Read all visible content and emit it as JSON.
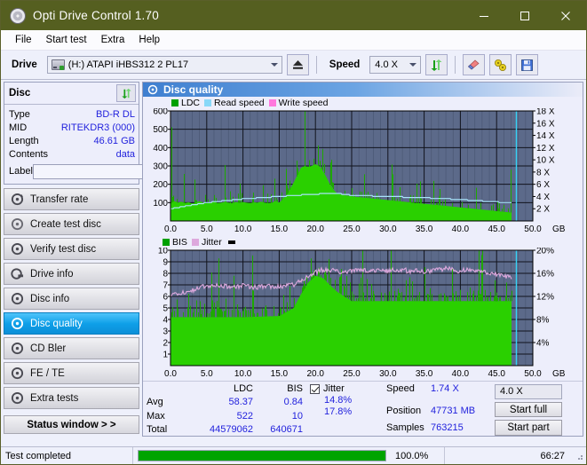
{
  "window": {
    "title": "Opti Drive Control 1.70",
    "icon": "disc-icon",
    "minimize": "minimize",
    "maximize": "maximize",
    "close": "close"
  },
  "menu": {
    "items": [
      {
        "label": "File",
        "name": "menu-file"
      },
      {
        "label": "Start test",
        "name": "menu-start-test"
      },
      {
        "label": "Extra",
        "name": "menu-extra"
      },
      {
        "label": "Help",
        "name": "menu-help"
      }
    ]
  },
  "toolbar": {
    "drive_label": "Drive",
    "drive_value": "(H:)  ATAPI iHBS312  2 PL17",
    "eject_icon": "eject-icon",
    "speed_label": "Speed",
    "speed_value": "4.0 X",
    "refresh_icon": "refresh-icon",
    "erase_icon": "eraser-icon",
    "tools_icon": "tools-icon",
    "save_icon": "save-icon"
  },
  "disc_panel": {
    "title": "Disc",
    "refresh_icon": "refresh-icon",
    "rows": [
      {
        "key": "Type",
        "value": "BD-R DL"
      },
      {
        "key": "MID",
        "value": "RITEKDR3 (000)"
      },
      {
        "key": "Length",
        "value": "46.61 GB"
      },
      {
        "key": "Contents",
        "value": "data"
      }
    ],
    "label_key": "Label",
    "label_value": "",
    "label_placeholder": "",
    "disc_button_icon": "cd-icon"
  },
  "nav": {
    "items": [
      {
        "label": "Transfer rate",
        "name": "sidebar-item-transfer-rate",
        "active": false
      },
      {
        "label": "Create test disc",
        "name": "sidebar-item-create-test-disc",
        "active": false
      },
      {
        "label": "Verify test disc",
        "name": "sidebar-item-verify-test-disc",
        "active": false
      },
      {
        "label": "Drive info",
        "name": "sidebar-item-drive-info",
        "active": false
      },
      {
        "label": "Disc info",
        "name": "sidebar-item-disc-info",
        "active": false
      },
      {
        "label": "Disc quality",
        "name": "sidebar-item-disc-quality",
        "active": true
      },
      {
        "label": "CD Bler",
        "name": "sidebar-item-cd-bler",
        "active": false
      },
      {
        "label": "FE / TE",
        "name": "sidebar-item-fe-te",
        "active": false
      },
      {
        "label": "Extra tests",
        "name": "sidebar-item-extra-tests",
        "active": false
      }
    ],
    "status_window": "Status window > >"
  },
  "panel": {
    "title": "Disc quality",
    "icon": "disc-quality-icon"
  },
  "chart_data": [
    {
      "type": "area",
      "name": "ldc-chart",
      "title": "",
      "xlabel": "GB",
      "ylabel": "",
      "xlim": [
        0,
        50
      ],
      "ylim": [
        0,
        600
      ],
      "y2lim": [
        0,
        18
      ],
      "y2label": "X",
      "grid": true,
      "legend_position": "top-left",
      "legend": [
        {
          "label": "LDC",
          "color": "#00a000"
        },
        {
          "label": "Read speed",
          "color": "#88d8f8"
        },
        {
          "label": "Write speed",
          "color": "#ff77dd"
        }
      ],
      "xticks": [
        "0.0",
        "5.0",
        "10.0",
        "15.0",
        "20.0",
        "25.0",
        "30.0",
        "35.0",
        "40.0",
        "45.0",
        "50.0"
      ],
      "yticks": [
        100,
        200,
        300,
        400,
        500,
        600
      ],
      "y2ticks": [
        "2 X",
        "4 X",
        "6 X",
        "8 X",
        "10 X",
        "12 X",
        "14 X",
        "16 X",
        "18 X"
      ],
      "data_end_gb": 47.0,
      "cursor_gb": 47.73,
      "series": [
        {
          "name": "LDC",
          "color": "#22c000",
          "x": [
            0,
            0.5,
            1,
            1.5,
            2,
            2.5,
            3,
            3.5,
            4,
            4.5,
            5,
            5.5,
            6,
            6.5,
            7,
            7.5,
            8,
            8.5,
            9,
            9.5,
            10,
            10.5,
            11,
            11.5,
            12,
            12.5,
            13,
            13.5,
            14,
            14.5,
            15,
            15.5,
            16,
            16.5,
            17,
            17.5,
            18,
            18.5,
            19,
            19.5,
            20,
            20.5,
            21,
            21.5,
            22,
            22.5,
            23,
            23.5,
            24,
            24.5,
            25,
            25.5,
            26,
            26.5,
            27,
            27.5,
            28,
            28.5,
            29,
            29.5,
            30,
            30.5,
            31,
            31.5,
            32,
            32.5,
            33,
            33.5,
            34,
            34.5,
            35,
            35.5,
            36,
            36.5,
            37,
            37.5,
            38,
            38.5,
            39,
            39.5,
            40,
            40.5,
            41,
            41.5,
            42,
            42.5,
            43,
            43.5,
            44,
            44.5,
            45,
            45.5,
            46,
            46.5,
            47
          ],
          "values": [
            95,
            110,
            100,
            105,
            98,
            102,
            95,
            100,
            108,
            100,
            96,
            100,
            105,
            98,
            100,
            104,
            100,
            98,
            104,
            100,
            103,
            100,
            98,
            102,
            100,
            105,
            100,
            98,
            100,
            110,
            100,
            120,
            140,
            175,
            210,
            250,
            290,
            300,
            295,
            300,
            310,
            300,
            275,
            240,
            200,
            170,
            150,
            145,
            140,
            138,
            135,
            132,
            130,
            128,
            126,
            124,
            122,
            120,
            118,
            116,
            114,
            112,
            110,
            108,
            106,
            104,
            102,
            100,
            98,
            96,
            94,
            92,
            90,
            88,
            86,
            84,
            82,
            80,
            78,
            76,
            74,
            72,
            70,
            68,
            66,
            64,
            62,
            60,
            58,
            56,
            54,
            52,
            50,
            48,
            46
          ]
        },
        {
          "name": "Read speed",
          "color": "#a8e4fb",
          "x": [
            0,
            5,
            10,
            15,
            20,
            23,
            25,
            30,
            35,
            40,
            45,
            47
          ],
          "values": [
            2.0,
            3.0,
            3.6,
            4.0,
            4.4,
            4.5,
            4.2,
            4.0,
            3.8,
            3.5,
            3.1,
            3.0
          ]
        }
      ],
      "spikes_max": 522
    },
    {
      "type": "area",
      "name": "bis-jitter-chart",
      "title": "",
      "xlabel": "GB",
      "ylabel": "",
      "xlim": [
        0,
        50
      ],
      "ylim": [
        0,
        10
      ],
      "y2lim": [
        0,
        20
      ],
      "y2label": "%",
      "grid": true,
      "legend_position": "top-left",
      "legend": [
        {
          "label": "BIS",
          "color": "#00a000"
        },
        {
          "label": "Jitter",
          "color": "#dda8dd"
        }
      ],
      "xticks": [
        "0.0",
        "5.0",
        "10.0",
        "15.0",
        "20.0",
        "25.0",
        "30.0",
        "35.0",
        "40.0",
        "45.0",
        "50.0"
      ],
      "yticks": [
        1,
        2,
        3,
        4,
        5,
        6,
        7,
        8,
        9,
        10
      ],
      "y2ticks": [
        "4%",
        "8%",
        "12%",
        "16%",
        "20%"
      ],
      "data_end_gb": 47.0,
      "cursor_gb": 47.73,
      "series": [
        {
          "name": "BIS",
          "color": "#22c000",
          "x": [
            0,
            5,
            10,
            15,
            17,
            18,
            19,
            20,
            21,
            22,
            23,
            25,
            30,
            35,
            40,
            45,
            47
          ],
          "values": [
            4.2,
            4.2,
            4.2,
            4.3,
            5.0,
            6.2,
            7.2,
            7.8,
            7.6,
            7.0,
            6.4,
            5.6,
            5.6,
            5.6,
            5.6,
            5.6,
            5.6
          ]
        },
        {
          "name": "Jitter",
          "color": "#dda8dd",
          "x": [
            0,
            1,
            2,
            3,
            4,
            5,
            6,
            7,
            8,
            9,
            10,
            11,
            12,
            13,
            14,
            15,
            16,
            17,
            18,
            19,
            20,
            21,
            22,
            23,
            24,
            25,
            26,
            27,
            28,
            29,
            30,
            31,
            32,
            33,
            34,
            35,
            36,
            37,
            38,
            39,
            40,
            41,
            42,
            43,
            44,
            45,
            46,
            47
          ],
          "values": [
            6.1,
            6.3,
            6.4,
            6.5,
            6.8,
            6.9,
            6.9,
            6.9,
            6.9,
            6.85,
            6.9,
            6.85,
            6.8,
            6.85,
            6.9,
            6.85,
            6.9,
            7.0,
            7.4,
            7.8,
            8.1,
            8.3,
            8.3,
            8.2,
            8.1,
            8.2,
            8.3,
            8.2,
            8.2,
            8.3,
            8.2,
            8.3,
            8.3,
            8.2,
            8.2,
            8.1,
            8.2,
            8.3,
            8.4,
            8.3,
            8.2,
            8.3,
            8.2,
            8.1,
            8.0,
            7.9,
            7.8,
            7.7
          ]
        }
      ]
    }
  ],
  "stats": {
    "col_headers": [
      "LDC",
      "BIS"
    ],
    "rows": [
      {
        "label": "Avg",
        "ldc": "58.37",
        "bis": "0.84"
      },
      {
        "label": "Max",
        "ldc": "522",
        "bis": "10"
      },
      {
        "label": "Total",
        "ldc": "44579062",
        "bis": "640671"
      }
    ],
    "jitter": {
      "checked": true,
      "label": "Jitter",
      "avg": "14.8%",
      "max": "17.8%"
    },
    "right": [
      {
        "label": "Speed",
        "value": "1.74 X"
      },
      {
        "label": "Position",
        "value": "47731 MB"
      },
      {
        "label": "Samples",
        "value": "763215"
      }
    ],
    "speed_select": "4.0 X",
    "start_full": "Start full",
    "start_part": "Start part"
  },
  "statusbar": {
    "message": "Test completed",
    "progress_percent": 100.0,
    "progress_text": "100.0%",
    "elapsed": "66:27"
  },
  "colors": {
    "titlebar": "#555f20",
    "accent_blue": "#2222dd",
    "plot_bg": "#5c6a8a",
    "green": "#22c000",
    "progress_green": "#00a400",
    "selected_nav": "#0e9fe8"
  }
}
